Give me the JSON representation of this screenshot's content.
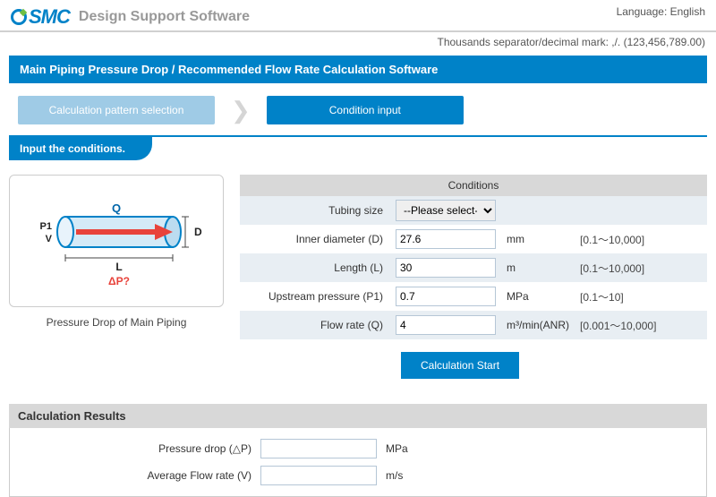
{
  "header": {
    "brand": "SMC",
    "subtitle": "Design Support Software",
    "language_label": "Language:",
    "language_value": "English",
    "separator_note": "Thousands separator/decimal mark: ,/. (123,456,789.00)"
  },
  "titlebar": "Main Piping Pressure Drop / Recommended Flow Rate Calculation Software",
  "steps": {
    "pattern_selection": "Calculation pattern selection",
    "condition_input": "Condition input"
  },
  "instruction": "Input the conditions.",
  "diagram": {
    "caption": "Pressure Drop of Main Piping",
    "P1_label": "P1",
    "V_label": "V",
    "Q_label": "Q",
    "D_label": "D",
    "L_label": "L",
    "dP_label": "ΔP?"
  },
  "conditions": {
    "header": "Conditions",
    "tubing_size": {
      "label": "Tubing size",
      "value": "--Please select--"
    },
    "inner_diameter": {
      "label": "Inner diameter (D)",
      "value": "27.6",
      "unit": "mm",
      "range": "[0.1～10,000]"
    },
    "length": {
      "label": "Length (L)",
      "value": "30",
      "unit": "m",
      "range": "[0.1～10,000]"
    },
    "upstream_pressure": {
      "label": "Upstream pressure (P1)",
      "value": "0.7",
      "unit": "MPa",
      "range": "[0.1～10]"
    },
    "flow_rate": {
      "label": "Flow rate (Q)",
      "value": "4",
      "unit": "m³/min(ANR)",
      "range": "[0.001～10,000]"
    }
  },
  "calc_button": "Calculation Start",
  "results": {
    "header": "Calculation Results",
    "pressure_drop": {
      "label": "Pressure drop (△P)",
      "value": "",
      "unit": "MPa"
    },
    "avg_flow_rate": {
      "label": "Average Flow rate (V)",
      "value": "",
      "unit": "m/s"
    }
  }
}
